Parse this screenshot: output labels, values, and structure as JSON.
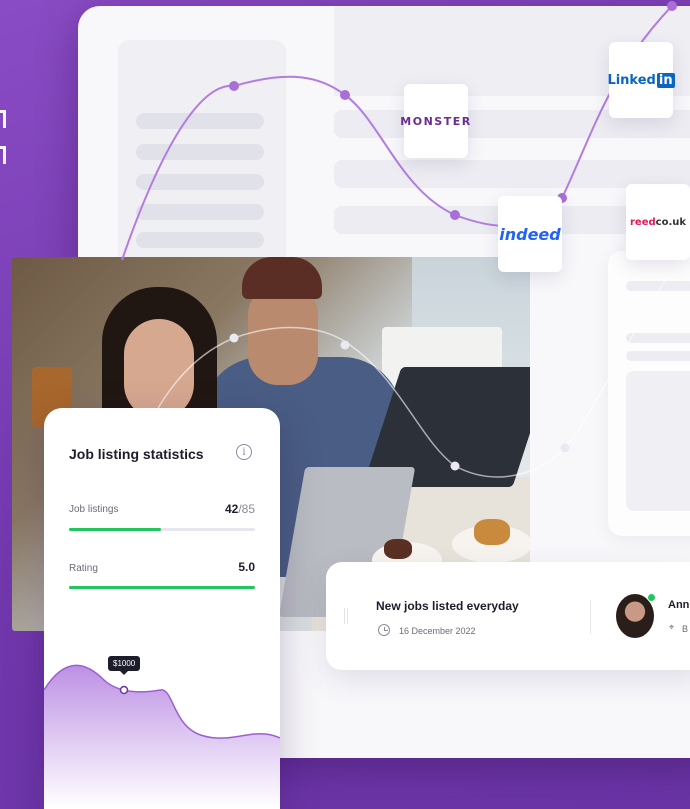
{
  "logos": {
    "monster": "MONSTER",
    "linkedin_text": "Linked",
    "linkedin_in": "in",
    "indeed": "indeed",
    "reed_prefix": "reed",
    "reed_suffix": "co.uk"
  },
  "stats_card": {
    "title": "Job listing statistics",
    "info_icon": "info-icon",
    "job_listings_label": "Job listings",
    "job_listings_value": "42",
    "job_listings_total": "/85",
    "job_listings_progress": 0.494,
    "rating_label": "Rating",
    "rating_value": "5.0",
    "rating_progress": 1.0,
    "tooltip": "$1000"
  },
  "info_bar": {
    "title": "New jobs listed everyday",
    "date": "16 December 2022",
    "clock_icon": "clock-icon",
    "person_name": "Ann",
    "location": "B",
    "location_icon": "map-pin-icon"
  },
  "colors": {
    "background": "#7b3fb5",
    "accent": "#a96fd8",
    "success": "#22c55e"
  }
}
